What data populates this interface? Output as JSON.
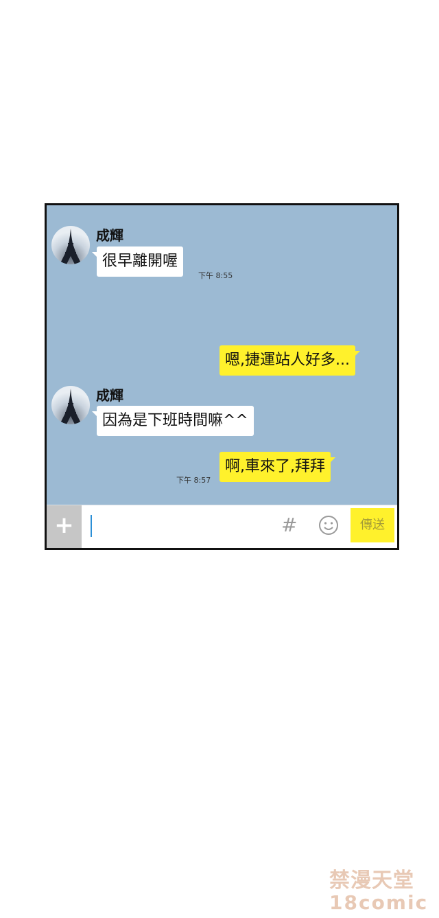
{
  "messages": [
    {
      "sender": "成輝",
      "text": "很早離開喔",
      "time": "下午 8:55"
    },
    {
      "text": "嗯,捷運站人好多..."
    },
    {
      "sender": "成輝",
      "text": "因為是下班時間嘛^^"
    },
    {
      "text": "啊,車來了,拜拜",
      "time": "下午 8:57"
    }
  ],
  "input": {
    "plus_label": "+",
    "hash_label": "#",
    "send_label": "傳送"
  },
  "watermark": {
    "line1": "禁漫天堂",
    "line2": "18comic"
  },
  "colors": {
    "chat_bg": "#9cbad3",
    "outgoing_bubble": "#fff12c",
    "incoming_bubble": "#ffffff"
  },
  "icons": [
    "avatar-eiffel-tower",
    "smiley-icon",
    "plus-icon",
    "hash-icon"
  ]
}
